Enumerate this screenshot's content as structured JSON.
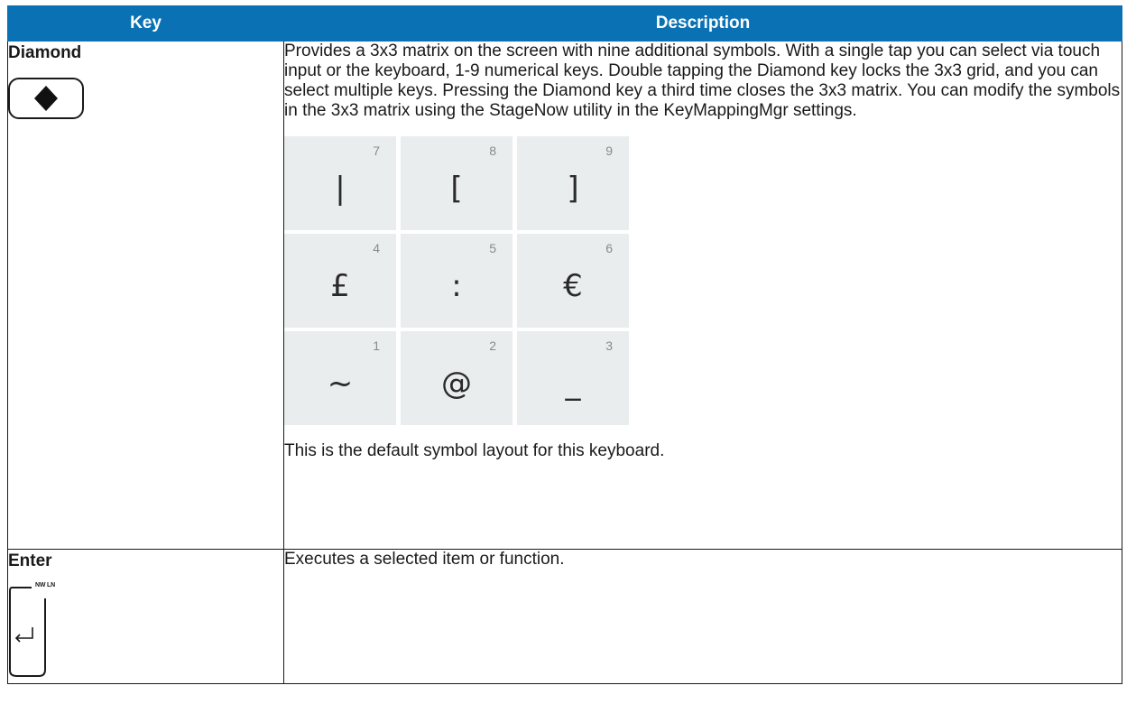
{
  "table": {
    "headers": {
      "key": "Key",
      "description": "Description"
    },
    "rows": [
      {
        "key_name": "Diamond",
        "key_icon": "diamond-key-icon",
        "description": "Provides a 3x3 matrix on the screen with nine additional symbols. With a single tap you can select via touch input or the keyboard, 1-9 numerical keys. Double tapping the Diamond key locks the 3x3 grid, and you can select multiple keys. Pressing the Diamond key a third time closes the 3x3 matrix. You can modify the symbols in the 3x3 matrix using the StageNow utility in the KeyMappingMgr settings.",
        "matrix": [
          {
            "num": "7",
            "symbol": "|"
          },
          {
            "num": "8",
            "symbol": "["
          },
          {
            "num": "9",
            "symbol": "]"
          },
          {
            "num": "4",
            "symbol": "£"
          },
          {
            "num": "5",
            "symbol": ":"
          },
          {
            "num": "6",
            "symbol": "€"
          },
          {
            "num": "1",
            "symbol": "~"
          },
          {
            "num": "2",
            "symbol": "@"
          },
          {
            "num": "3",
            "symbol": "_"
          }
        ],
        "footnote": "This is the default symbol layout for this keyboard."
      },
      {
        "key_name": "Enter",
        "key_icon": "enter-key-icon",
        "key_label": "NW LN",
        "description": "Executes a selected item or function."
      }
    ]
  },
  "colors": {
    "header_bg": "#0a72b4",
    "header_text": "#ffffff",
    "matrix_cell": "#e9edee"
  }
}
